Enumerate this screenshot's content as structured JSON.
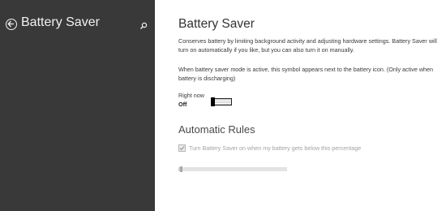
{
  "sidebar": {
    "title": "Battery Saver",
    "back_icon": "back-arrow-icon",
    "search_icon": "search-icon",
    "background_color": "#393939"
  },
  "main": {
    "title": "Battery Saver",
    "description_1": "Conserves battery by limiting background activity and adjusting hardware settings. Battery Saver will turn on automatically if you like, but you can also turn it on manually.",
    "description_2": "When battery saver mode is active, this symbol appears next to the battery icon. (Only active when battery is discharging)",
    "toggle": {
      "label": "Right now",
      "state": "Off",
      "on": false
    },
    "automatic_rules": {
      "title": "Automatic Rules",
      "checkbox_label": "Turn Battery Saver on when my battery gets below this percentage",
      "checkbox_checked": true,
      "checkbox_enabled": false,
      "slider_fraction": 0.02
    }
  }
}
